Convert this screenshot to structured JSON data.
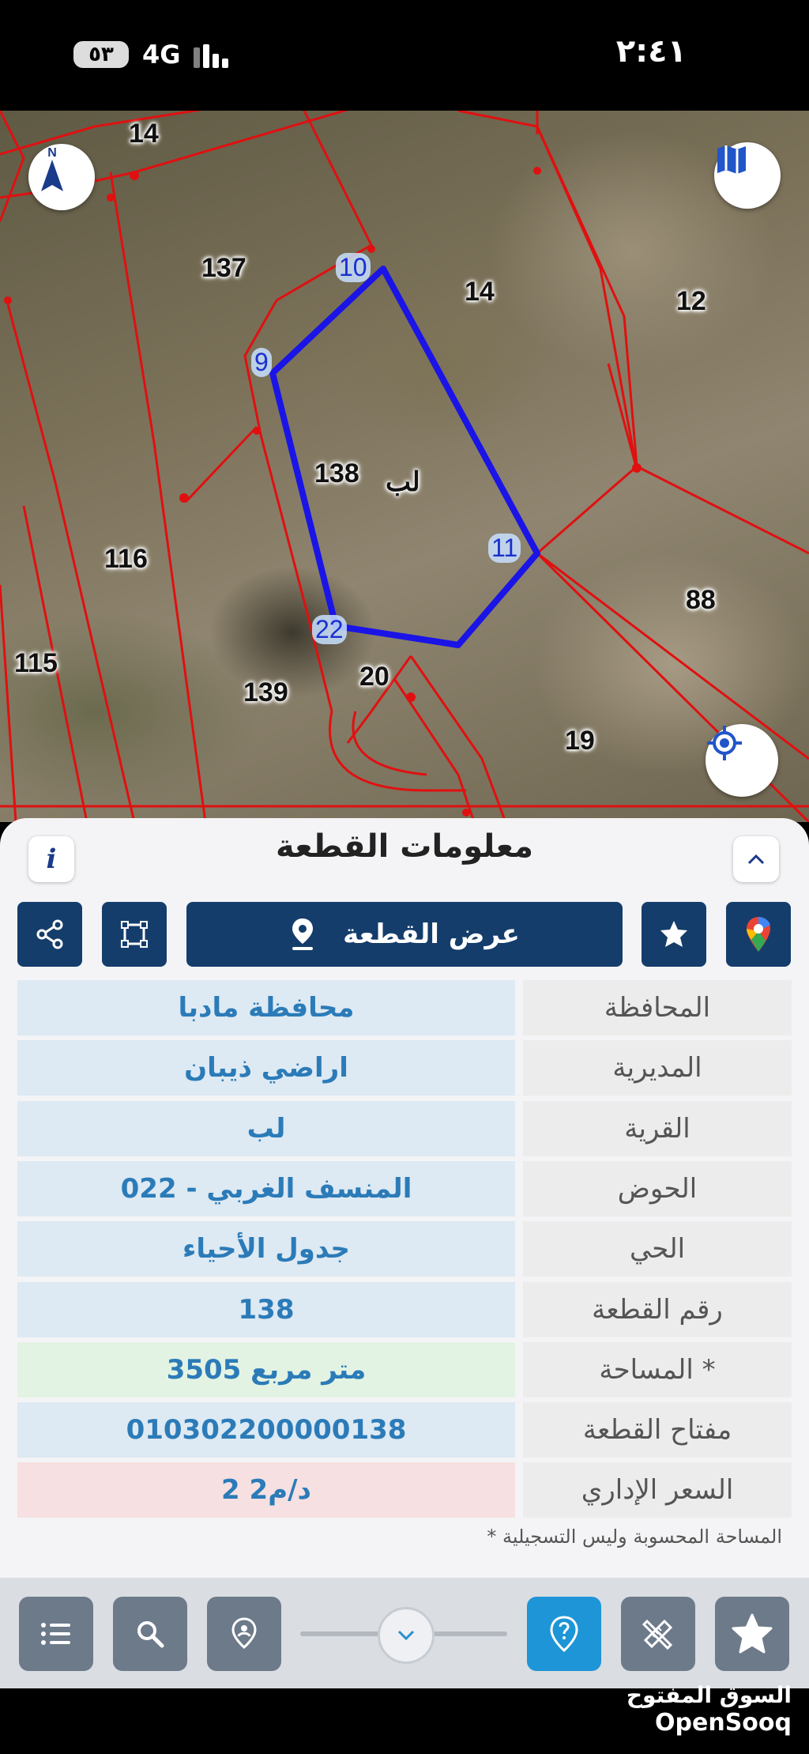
{
  "status_bar": {
    "battery": "٥٣",
    "network": "4G",
    "time": "٢:٤١"
  },
  "map": {
    "parcel_numbers": [
      "14",
      "137",
      "14",
      "12",
      "138",
      "116",
      "88",
      "115",
      "139",
      "20",
      "19"
    ],
    "village_label": "لب",
    "vertex_labels": [
      "10",
      "9",
      "11",
      "22"
    ],
    "compass_letter": "N",
    "colors": {
      "parcel_lines": "#e01010",
      "selected_parcel": "#1a14e6"
    }
  },
  "panel": {
    "title": "معلومات القطعة",
    "info_icon": "i",
    "view_parcel_button": "عرض القطعة",
    "rows": [
      {
        "label": "المحافظة",
        "value": "محافظة مادبا"
      },
      {
        "label": "المديرية",
        "value": "اراضي ذيبان"
      },
      {
        "label": "القرية",
        "value": "لب"
      },
      {
        "label": "الحوض",
        "value": "المنسف الغربي - 022"
      },
      {
        "label": "الحي",
        "value": "جدول الأحياء"
      },
      {
        "label": "رقم القطعة",
        "value": "138"
      },
      {
        "label": "المساحة *",
        "value": "3505   متر مربع"
      },
      {
        "label": "مفتاح القطعة",
        "value": "010302200000138"
      },
      {
        "label": "السعر الإداري",
        "value": "2 د/م2"
      }
    ],
    "footnote": "* المساحة المحسوبة وليس التسجيلية",
    "colors": {
      "value_default": "#dde9f3",
      "value_area": "#e3f3e3",
      "value_price": "#f6e0e2",
      "action_blue": "#143d6b"
    }
  },
  "watermark": {
    "arabic": "السوق المفتوح",
    "english": "OpenSooq"
  }
}
